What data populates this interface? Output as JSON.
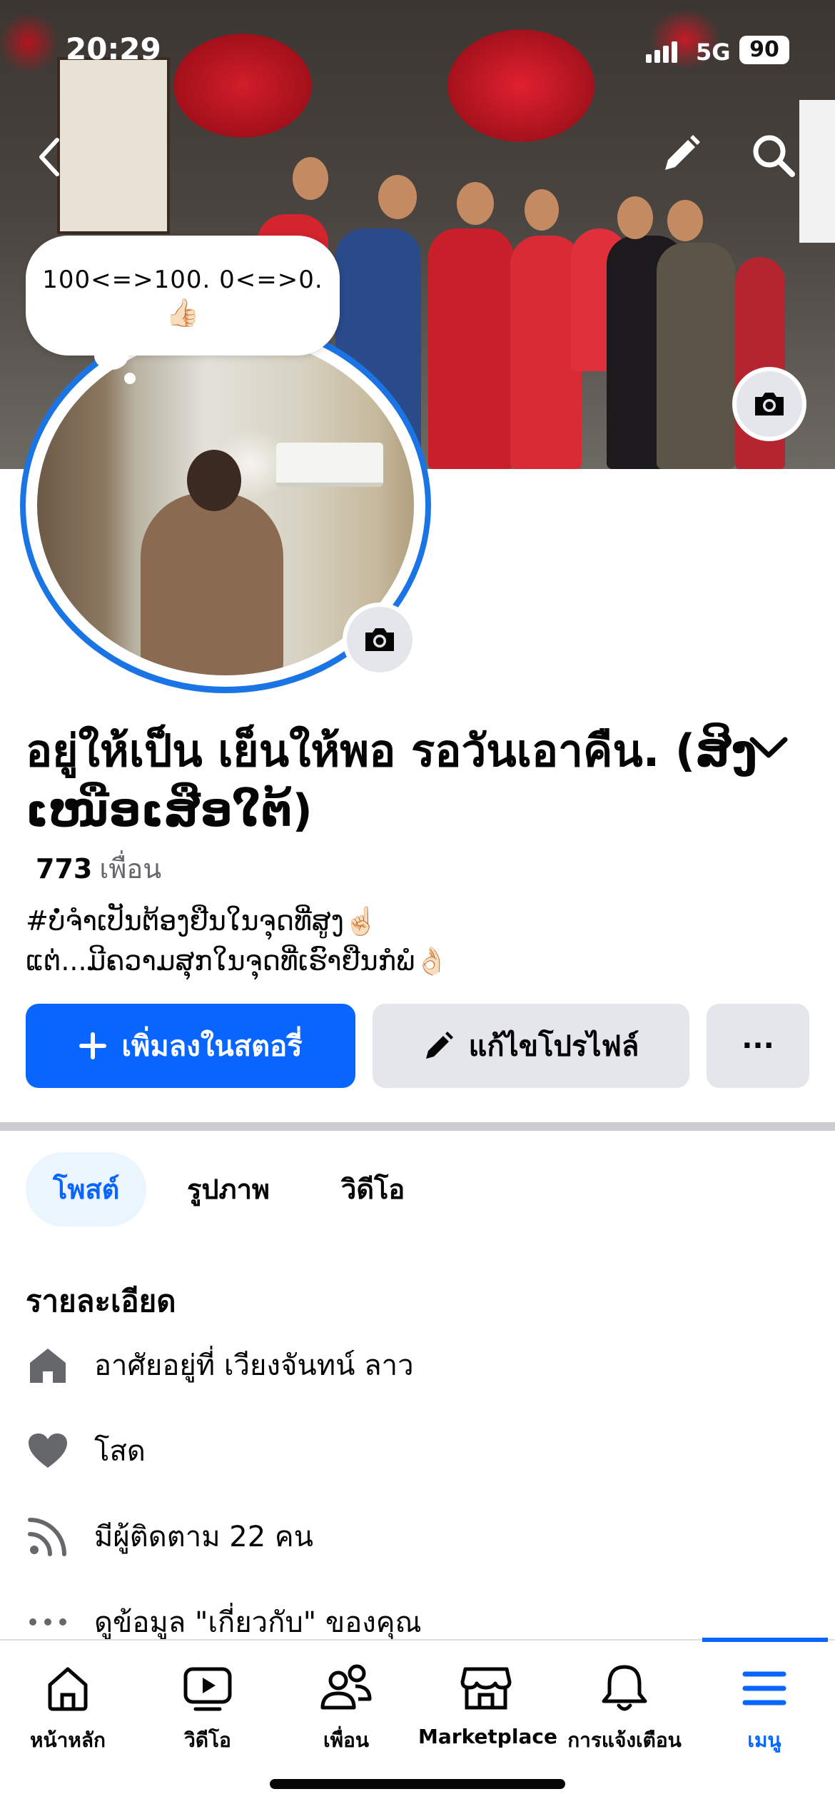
{
  "status_bar": {
    "time": "20:29",
    "network": "5G",
    "battery": "90"
  },
  "bubble": {
    "text": "100<=>100.  0<=>0.",
    "emoji": "👍🏻"
  },
  "profile": {
    "name": "อยู่ให้เป็น เย็นให้พอ รอวันเอาคืน. (ສິງ ເໜືອເສືອໃຕ້)",
    "friends_count": "773",
    "friends_label": "เพื่อน",
    "bio_line1": "#ບໍ່ຈຳເປັນຕ້ອງຢືນໃນຈຸດທີ່ສູງ☝🏻",
    "bio_line2": "ແຕ່...ມີຄວາມສຸກໃນຈຸດທີ່ເຮົາຢືນກໍພໍ👌🏻"
  },
  "actions": {
    "add_story": "เพิ่มลงในสตอรี่",
    "edit_profile": "แก้ไขโปรไฟล์",
    "more": "···"
  },
  "tabs": [
    {
      "label": "โพสต์",
      "active": true
    },
    {
      "label": "รูปภาพ",
      "active": false
    },
    {
      "label": "วิดีโอ",
      "active": false
    }
  ],
  "details": {
    "title": "รายละเอียด",
    "items": [
      {
        "icon": "home-icon",
        "text": "อาศัยอยู่ที่ เวียงจันทน์ ลาว"
      },
      {
        "icon": "heart-icon",
        "text": "โสด"
      },
      {
        "icon": "rss-icon",
        "text": "มีผู้ติดตาม 22 คน"
      },
      {
        "icon": "more-dots-icon",
        "text": "ดูข้อมูล \"เกี่ยวกับ\" ของคุณ"
      }
    ]
  },
  "bottom_nav": [
    {
      "icon": "home-icon",
      "label": "หน้าหลัก",
      "active": false
    },
    {
      "icon": "video-icon",
      "label": "วิดีโอ",
      "active": false
    },
    {
      "icon": "friends-icon",
      "label": "เพื่อน",
      "active": false
    },
    {
      "icon": "marketplace-icon",
      "label": "Marketplace",
      "active": false
    },
    {
      "icon": "bell-icon",
      "label": "การแจ้งเตือน",
      "active": false
    },
    {
      "icon": "menu-icon",
      "label": "เมนู",
      "active": true
    }
  ],
  "colors": {
    "accent": "#0866ff",
    "secondary_button": "#e4e6eb",
    "muted_text": "#65676b"
  }
}
